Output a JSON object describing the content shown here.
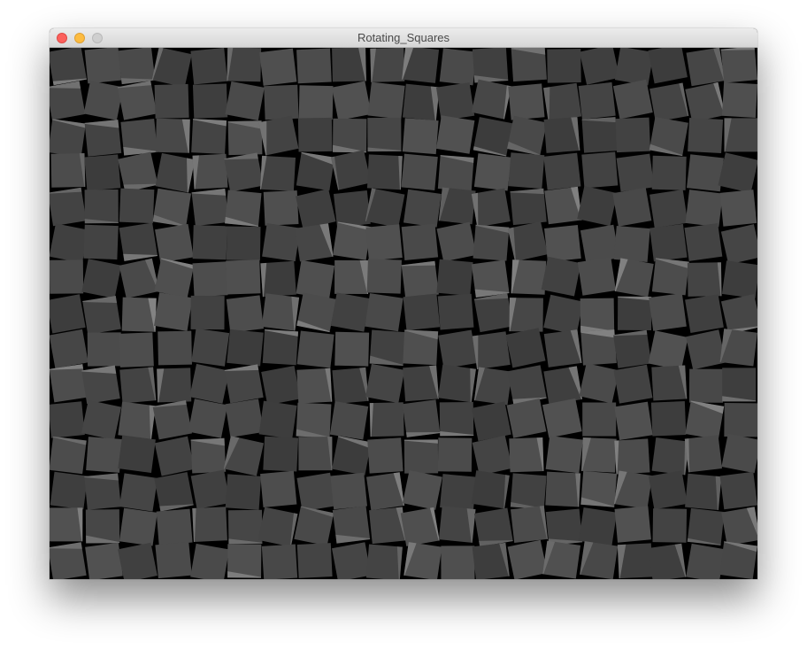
{
  "window": {
    "title": "Rotating_Squares"
  },
  "colors": {
    "canvas_background": "#000000",
    "square_fill": "#464646",
    "square_highlight": "#9a9a9a",
    "close_button": "#fc605c",
    "minimize_button": "#fdbc40",
    "zoom_button": "#cfcfcf"
  },
  "grid": {
    "columns": 20,
    "rows": 15
  }
}
